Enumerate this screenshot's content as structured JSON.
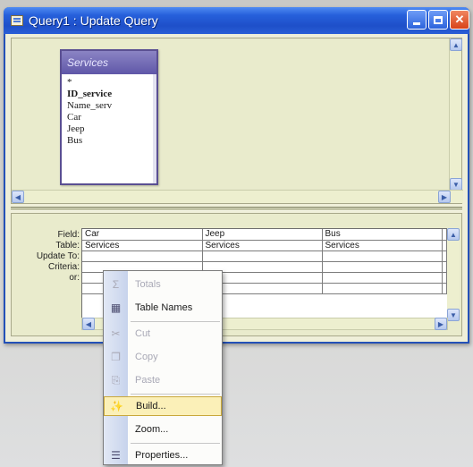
{
  "window": {
    "title": "Query1 : Update Query",
    "buttons": {
      "minimize": "minimize",
      "maximize": "maximize",
      "close": "✕"
    }
  },
  "field_list": {
    "title": "Services",
    "items": [
      "*",
      "ID_service",
      "Name_serv",
      "Car",
      "Jeep",
      "Bus"
    ]
  },
  "grid": {
    "row_labels": [
      "Field:",
      "Table:",
      "Update To:",
      "Criteria:",
      "or:"
    ],
    "columns": [
      {
        "field": "Car",
        "table": "Services"
      },
      {
        "field": "Jeep",
        "table": "Services"
      },
      {
        "field": "Bus",
        "table": "Services"
      }
    ]
  },
  "context_menu": {
    "items": [
      {
        "label": "Totals",
        "icon": "sigma-icon",
        "glyph": "Σ",
        "disabled": true
      },
      {
        "label": "Table Names",
        "icon": "table-names-icon",
        "glyph": "▦",
        "disabled": false
      },
      {
        "label": "Cut",
        "icon": "scissors-icon",
        "glyph": "✂",
        "disabled": true
      },
      {
        "label": "Copy",
        "icon": "copy-icon",
        "glyph": "❐",
        "disabled": true
      },
      {
        "label": "Paste",
        "icon": "paste-icon",
        "glyph": "⎘",
        "disabled": true
      },
      {
        "label": "Build...",
        "icon": "build-wand-icon",
        "glyph": "✨",
        "disabled": false,
        "highlighted": true
      },
      {
        "label": "Zoom...",
        "icon": "zoom-icon",
        "glyph": "",
        "disabled": false
      },
      {
        "label": "Properties...",
        "icon": "properties-icon",
        "glyph": "☰",
        "disabled": false
      }
    ]
  },
  "colors": {
    "titlebar": "#2660db",
    "pane_bg": "#e9ebcc",
    "menu_highlight": "#fbf0b8"
  }
}
